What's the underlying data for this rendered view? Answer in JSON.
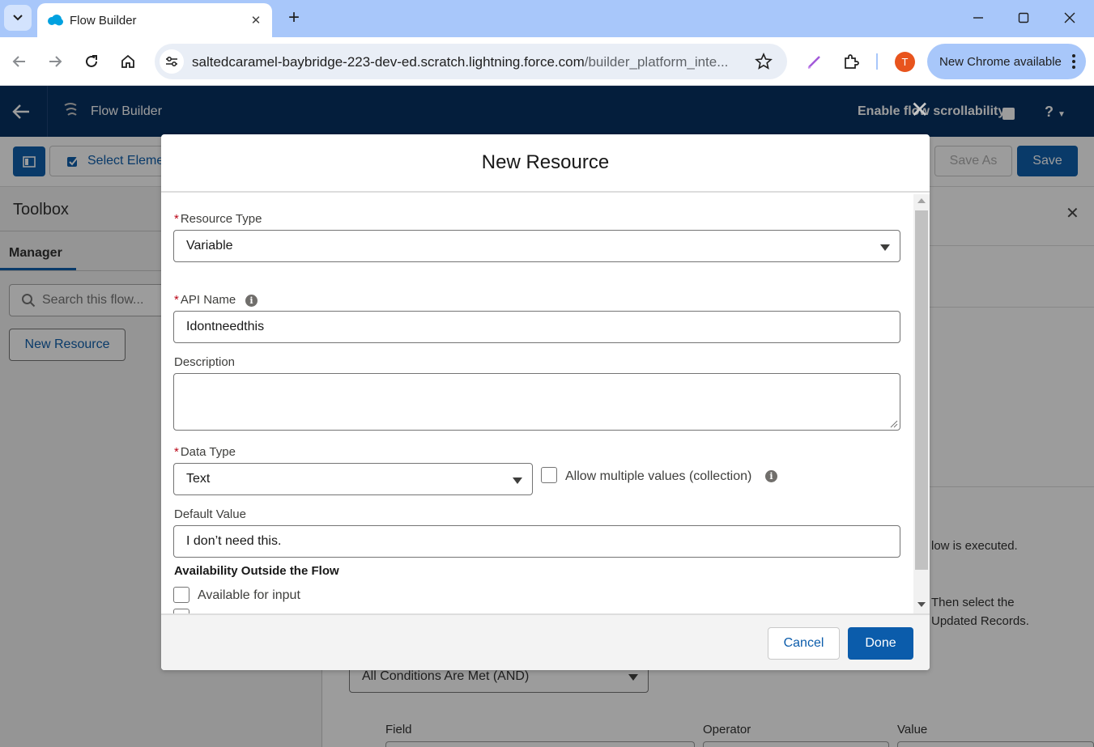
{
  "browser": {
    "tab_title": "Flow Builder",
    "url_host": "saltedcaramel-baybridge-223-dev-ed.scratch.lightning.force.com",
    "url_path": "/builder_platform_inte...",
    "profile_initial": "T",
    "update_label": "New Chrome available"
  },
  "app": {
    "title": "Flow Builder",
    "scroll_label": "Enable flow scrollability",
    "select_elements_label": "Select Eleme",
    "save_as_label": "Save As",
    "save_label": "Save"
  },
  "toolbox": {
    "title": "Toolbox",
    "tab_label": "Manager",
    "search_placeholder": "Search this flow...",
    "new_resource_label": "New Resource"
  },
  "background_panel": {
    "text1": "low is executed.",
    "text2a": "Then select the",
    "text2b": "Updated Records.",
    "condition_select": "All Conditions Are Met (AND)",
    "col_field": "Field",
    "col_operator": "Operator",
    "col_value": "Value"
  },
  "modal": {
    "title": "New Resource",
    "resource_type_label": "Resource Type",
    "resource_type_value": "Variable",
    "api_name_label": "API Name",
    "api_name_value": "Idontneedthis",
    "description_label": "Description",
    "description_value": "",
    "data_type_label": "Data Type",
    "data_type_value": "Text",
    "allow_multiple_label": "Allow multiple values (collection)",
    "default_value_label": "Default Value",
    "default_value_value": "I don’t need this.",
    "availability_heading": "Availability Outside the Flow",
    "available_input_label": "Available for input",
    "cancel_label": "Cancel",
    "done_label": "Done"
  },
  "colors": {
    "brand_blue": "#0b5cab",
    "header_navy": "#032d60",
    "required_red": "#ba0517",
    "chrome_blue": "#a8c7fa"
  }
}
